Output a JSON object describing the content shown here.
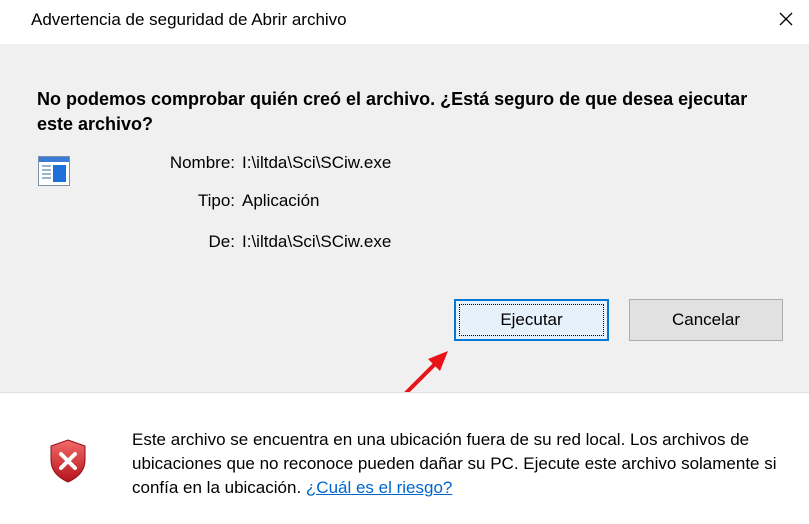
{
  "window": {
    "title": "Advertencia de seguridad de Abrir archivo",
    "close_glyph": "✕"
  },
  "main": {
    "heading": "No podemos comprobar quién creó el archivo. ¿Está seguro de que desea ejecutar este archivo?",
    "file_icon": "application-window-icon",
    "properties": [
      {
        "label": "Nombre:",
        "value": "I:\\iltda\\Sci\\SCiw.exe"
      },
      {
        "label": "Tipo:",
        "value": "Aplicación"
      },
      {
        "label": "De:",
        "value": "I:\\iltda\\Sci\\SCiw.exe"
      }
    ]
  },
  "buttons": {
    "run_label": "Ejecutar",
    "cancel_label": "Cancelar"
  },
  "annotation": {
    "arrow_color": "#e8141a"
  },
  "footer": {
    "warning_text": "Este archivo se encuentra en una ubicación fuera de su red local. Los archivos de ubicaciones que no reconoce pueden dañar su PC. Ejecute este archivo solamente si confía en la ubicación.",
    "risk_link": "¿Cuál es el riesgo?",
    "shield_icon": "security-shield-error-icon"
  },
  "colors": {
    "accent": "#0078d7",
    "link": "#0066cc",
    "shield_red": "#c8242c"
  }
}
